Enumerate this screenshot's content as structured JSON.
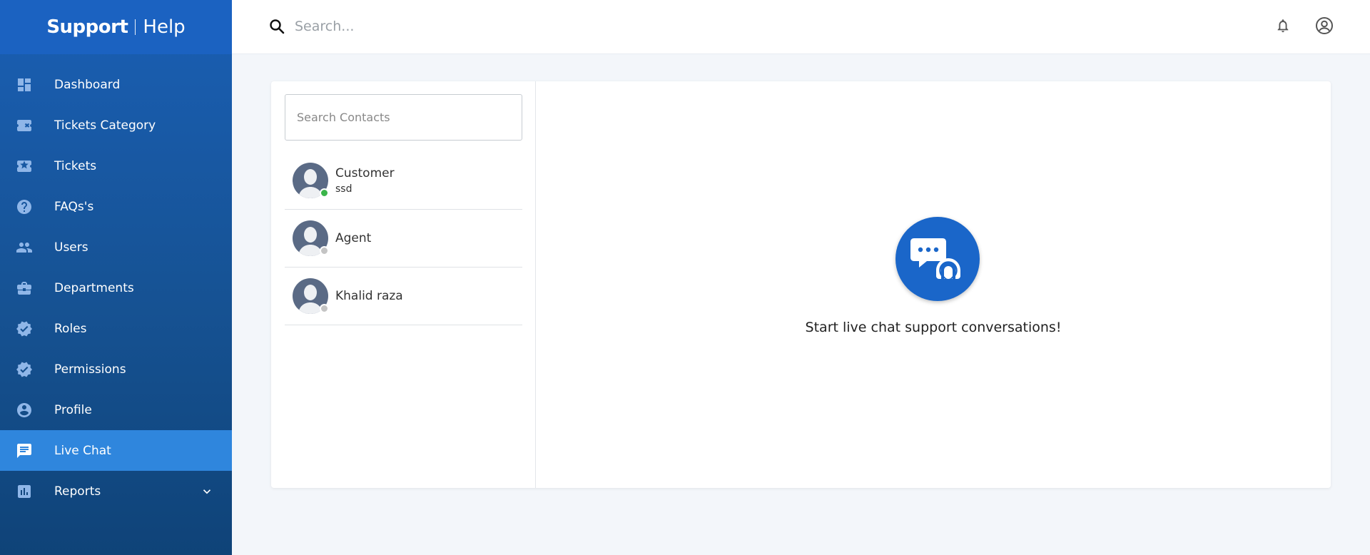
{
  "brand": {
    "primary": "Support",
    "secondary": "Help"
  },
  "search": {
    "placeholder": "Search..."
  },
  "sidebar": {
    "items": [
      {
        "label": "Dashboard",
        "icon": "dashboard-icon",
        "active": false
      },
      {
        "label": "Tickets Category",
        "icon": "ticket-icon",
        "active": false
      },
      {
        "label": "Tickets",
        "icon": "ticket-icon",
        "active": false
      },
      {
        "label": "FAQs's",
        "icon": "help-circle-icon",
        "active": false
      },
      {
        "label": "Users",
        "icon": "users-icon",
        "active": false
      },
      {
        "label": "Departments",
        "icon": "briefcase-icon",
        "active": false
      },
      {
        "label": "Roles",
        "icon": "verified-badge-icon",
        "active": false
      },
      {
        "label": "Permissions",
        "icon": "verified-badge-icon",
        "active": false
      },
      {
        "label": "Profile",
        "icon": "account-circle-icon",
        "active": false
      },
      {
        "label": "Live Chat",
        "icon": "chat-icon",
        "active": true
      },
      {
        "label": "Reports",
        "icon": "report-chart-icon",
        "active": false,
        "expandable": true
      }
    ]
  },
  "contacts": {
    "search_placeholder": "Search Contacts",
    "list": [
      {
        "name": "Customer",
        "subtitle": "ssd",
        "status": "online"
      },
      {
        "name": "Agent",
        "subtitle": "",
        "status": "offline"
      },
      {
        "name": "Khalid raza",
        "subtitle": "",
        "status": "offline"
      }
    ]
  },
  "chat": {
    "empty_message": "Start live chat support conversations!",
    "icon": "support-chat-headset-icon"
  },
  "colors": {
    "sidebar": "#1a5fb4",
    "active_item": "#2f86dd",
    "online": "#3bb54a",
    "offline": "#c4c4c4"
  }
}
